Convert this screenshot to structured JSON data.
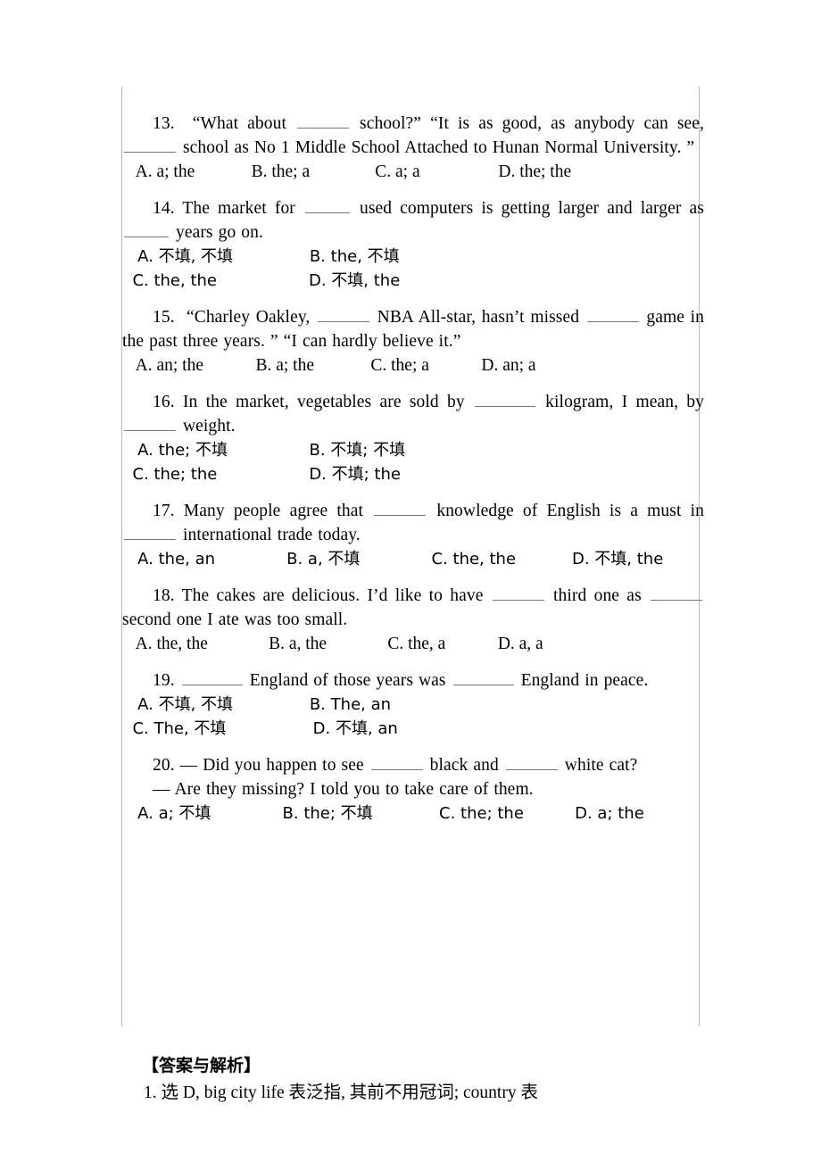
{
  "document": {
    "type": "exam-worksheet",
    "subject": "English grammar - articles",
    "page_background": "#ffffff",
    "text_color": "#000000",
    "border_color": "#b8b8b8"
  },
  "questions": [
    {
      "number": "13.",
      "stem_parts": [
        "“What about ",
        " school?” “It is as good, as anybody can see, ",
        " school as No 1 Middle School Attached to Hunan Normal University. ”"
      ],
      "options": "   A. a; the             B. the; a               C. a; a                  D. the; the"
    },
    {
      "number": "14.",
      "stem_parts": [
        "The market for ",
        " used computers is getting larger and larger as",
        " years go on."
      ],
      "options_line1": "   A. 不填, 不填               B. the, 不填",
      "options_line2": "  C. the, the                  D. 不填, the"
    },
    {
      "number": "15.",
      "stem_parts": [
        "“Charley Oakley, ",
        " NBA All-star, hasn’t missed ",
        " game in the past three years. ” “I can hardly believe it.”"
      ],
      "options": "   A. an; the            B. a; the             C. the; a            D. an; a"
    },
    {
      "number": "16.",
      "stem_parts": [
        "In the market, vegetables are sold by ",
        " kilogram, I mean, by ",
        " weight."
      ],
      "options_line1": "   A. the; 不填                B. 不填; 不填",
      "options_line2": "  C. the; the                  D. 不填; the"
    },
    {
      "number": "17.",
      "stem_parts": [
        "Many people agree that ",
        " knowledge of English is a must in ",
        " international trade today."
      ],
      "options": "   A. the, an              B. a, 不填              C. the, the           D. 不填, the"
    },
    {
      "number": "18.",
      "stem_parts": [
        "The cakes are delicious. I’d like to have ",
        " third one as ",
        " second one I ate was too small."
      ],
      "options": "   A. the, the              B. a, the              C. the, a            D. a, a"
    },
    {
      "number": "19.",
      "stem_parts": [
        "",
        " England of those years was ",
        " England in peace."
      ],
      "options_line1": "   A. 不填, 不填               B. The, an",
      "options_line2": "  C. The, 不填                 D. 不填, an"
    },
    {
      "number": "20.",
      "stem_parts": [
        "— Did you happen to see ",
        " black and ",
        " white cat?"
      ],
      "stem_line2": "— Are they missing? I told you to take care of them.",
      "options": "   A. a; 不填              B. the; 不填             C. the; the          D. a; the"
    }
  ],
  "answer_key": {
    "title": "【答案与解析】",
    "lines": [
      "1. 选 D, big city life 表泛指, 其前不用冠词; country 表"
    ]
  }
}
